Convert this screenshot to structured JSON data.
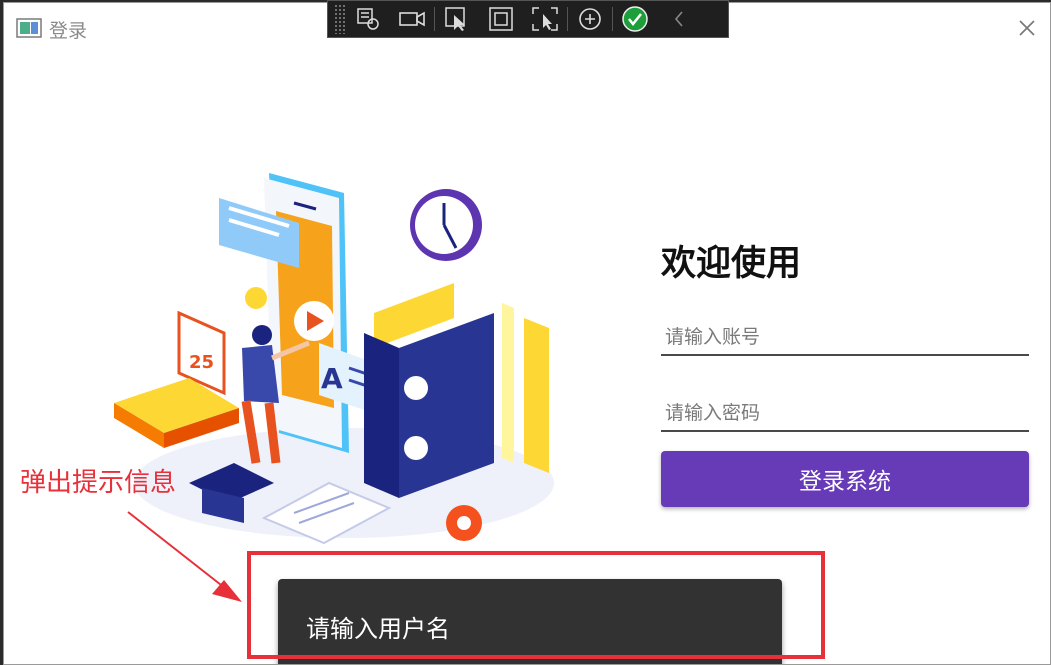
{
  "window": {
    "title": "登录"
  },
  "login": {
    "welcome": "欢迎使用",
    "account_placeholder": "请输入账号",
    "password_placeholder": "请输入密码",
    "login_button": "登录系统"
  },
  "snackbar": {
    "message": "请输入用户名"
  },
  "annotation": {
    "label": "弹出提示信息",
    "color": "#e8303a"
  },
  "illustration": {
    "calendar_day": "25",
    "badge_letter": "A"
  },
  "colors": {
    "accent": "#673ab7",
    "snackbar_bg": "#323232"
  },
  "debug_toolbar": {
    "icons": [
      "live-visual-tree-icon",
      "record-icon",
      "select-element-icon",
      "layout-adorner-icon",
      "track-focus-icon",
      "binding-failures-icon",
      "hot-reload-ok-icon",
      "collapse-icon"
    ]
  }
}
